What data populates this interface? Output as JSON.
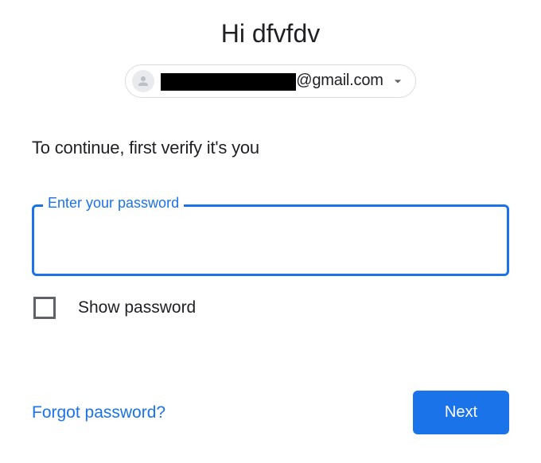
{
  "header": {
    "greeting": "Hi dfvfdv",
    "account": {
      "email_domain": "@gmail.com"
    }
  },
  "instruction": "To continue, first verify it's you",
  "password_field": {
    "label": "Enter your password",
    "value": ""
  },
  "show_password": {
    "label": "Show password",
    "checked": false
  },
  "footer": {
    "forgot_label": "Forgot password?",
    "next_label": "Next"
  }
}
